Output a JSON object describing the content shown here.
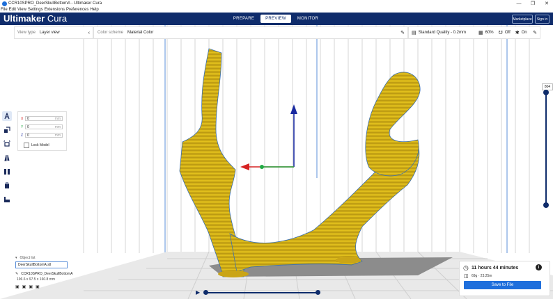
{
  "window": {
    "title": "CCR10SPRO_DeerSkullBottomA - Ultimaker Cura"
  },
  "menu": [
    "File",
    "Edit",
    "View",
    "Settings",
    "Extensions",
    "Preferences",
    "Help"
  ],
  "app": {
    "brand": "Ultimaker",
    "product": "Cura"
  },
  "stages": [
    {
      "label": "PREPARE"
    },
    {
      "label": "PREVIEW"
    },
    {
      "label": "MONITOR"
    }
  ],
  "topbar": {
    "marketplace": "Marketplace",
    "signin": "Sign in"
  },
  "view": {
    "type_label": "View type",
    "type_value": "Layer view"
  },
  "color_scheme": {
    "label": "Color scheme",
    "value": "Material Color"
  },
  "print_settings": {
    "profile": "Standard Quality - 0.2mm",
    "infill": "60%",
    "support": "Off",
    "adhesion": "On"
  },
  "transform": {
    "x": "0",
    "y": "0",
    "z": "0",
    "unit": "mm",
    "lock_label": "Lock Model"
  },
  "layer_slider": {
    "max_label": "804",
    "current": 804,
    "max": 804
  },
  "object_list": {
    "header": "Object list",
    "selected": "DeerSkullBottomA.stl",
    "file": "CCR10SPRO_DeerSkullBottomA",
    "dimensions": "196.6 x 97.5 x 160.8 mm"
  },
  "estimate": {
    "time": "11 hours 44 minutes",
    "material": "69g · 23.25m",
    "save_label": "Save to File"
  },
  "colors": {
    "topbar": "#0f2c6b",
    "accent": "#1f6fdc",
    "model": "#e6c41e",
    "model_shade": "#8f7405",
    "axis_x": "#d62222",
    "axis_y": "#22aa44",
    "axis_z": "#1a2aa0",
    "bed_shadow": "#8c8c8c"
  },
  "icons": [
    "cura-app-icon",
    "minimize-icon",
    "maximize-icon",
    "close-icon",
    "chevron-left-icon",
    "pencil-icon",
    "quality-icon",
    "infill-icon",
    "support-icon",
    "adhesion-icon",
    "move-tool-icon",
    "scale-tool-icon",
    "rotate-tool-icon",
    "mirror-tool-icon",
    "per-model-settings-icon",
    "support-blocker-icon",
    "layer-icon",
    "clock-icon",
    "info-icon",
    "spool-icon",
    "play-icon"
  ]
}
